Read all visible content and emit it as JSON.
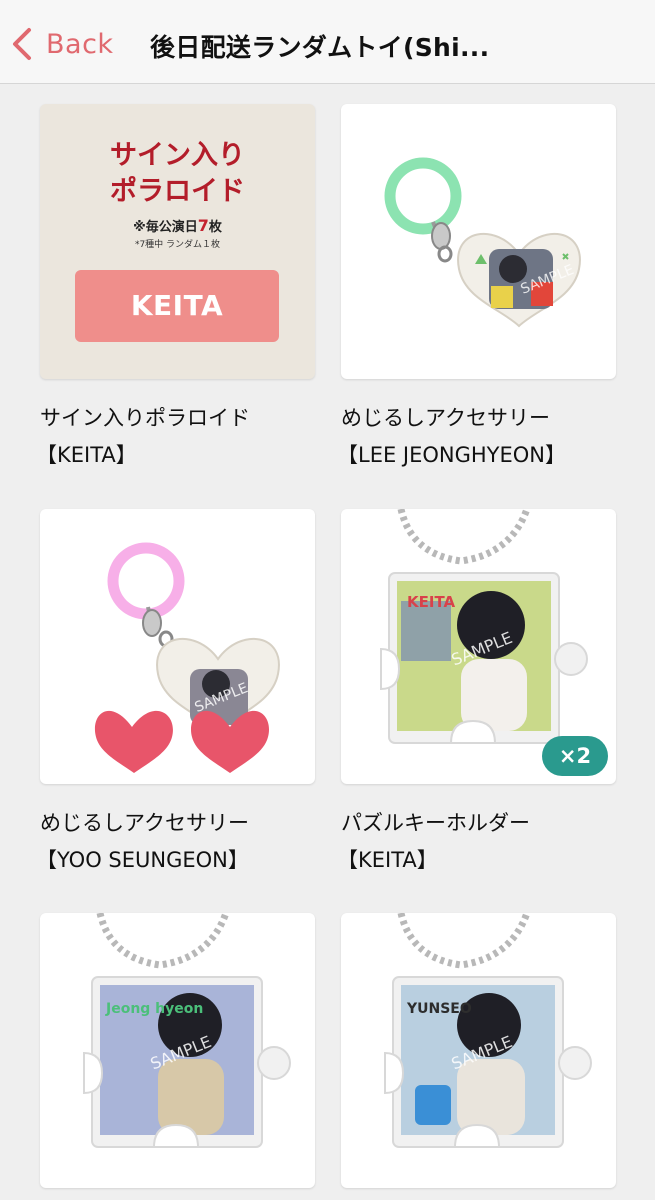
{
  "nav": {
    "back_label": "Back",
    "title": "後日配送ランダムトイ(Shi..."
  },
  "items": [
    {
      "title": "サイン入りポラロイド",
      "subtitle": "【KEITA】",
      "image": {
        "title_line1": "サイン入り",
        "title_line2": "ポラロイド",
        "note_prefix": "※毎公演日",
        "note_count": "7",
        "note_suffix": "枚",
        "note2": "*7種中 ランダム１枚",
        "member_label": "KEITA",
        "colors": {
          "bg": "#ebe6dd",
          "title": "#b31d2a",
          "button": "#ef8e8b"
        }
      }
    },
    {
      "title": "めじるしアクセサリー",
      "subtitle": "【LEE JEONGHYEON】",
      "image": {
        "ring_color": "#7fe0a8",
        "watermark": "SAMPLE"
      }
    },
    {
      "title": "めじるしアクセサリー",
      "subtitle": "【YOO SEUNGEON】",
      "image": {
        "ring_color": "#f6a6e6",
        "watermark": "SAMPLE",
        "heart_color": "#e8556a"
      }
    },
    {
      "title": "パズルキーホルダー",
      "subtitle": "【KEITA】",
      "badge": "×2",
      "image": {
        "name_sticker": "KEITA",
        "watermark": "SAMPLE",
        "bg": "#c9d98a"
      }
    },
    {
      "title": "",
      "subtitle": "",
      "image": {
        "name_sticker": "Jeong hyeon",
        "watermark": "SAMPLE",
        "bg": "#a9b4d8"
      }
    },
    {
      "title": "",
      "subtitle": "",
      "image": {
        "name_sticker": "YUNSEO",
        "watermark": "SAMPLE",
        "bg": "#b9cfe0"
      }
    }
  ],
  "colors": {
    "accent": "#e0696f",
    "badge": "#2a9a8e"
  }
}
